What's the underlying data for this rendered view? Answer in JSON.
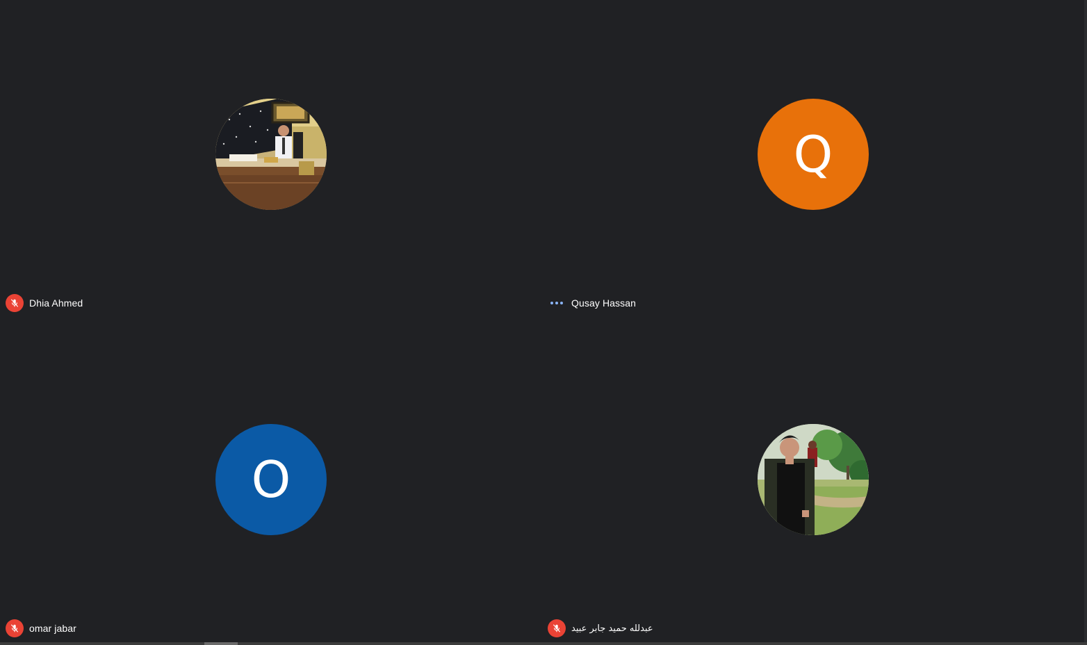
{
  "participants": [
    {
      "name": "Dhia Ahmed",
      "initial": "",
      "avatar": "photo-office-desk",
      "mic": "muted"
    },
    {
      "name": "Qusay Hassan",
      "initial": "Q",
      "avatar_color": "#e8710a",
      "mic": "speaking-indicator"
    },
    {
      "name": "omar jabar",
      "initial": "O",
      "avatar_color": "#0b5aa6",
      "mic": "muted"
    },
    {
      "name": "عبدلله حميد جابر عبيد",
      "initial": "",
      "avatar": "photo-outdoor-park",
      "mic": "muted"
    }
  ],
  "colors": {
    "background": "#202124",
    "muted_badge": "#ea4335",
    "speaking_dots": "#8ab4f8"
  }
}
